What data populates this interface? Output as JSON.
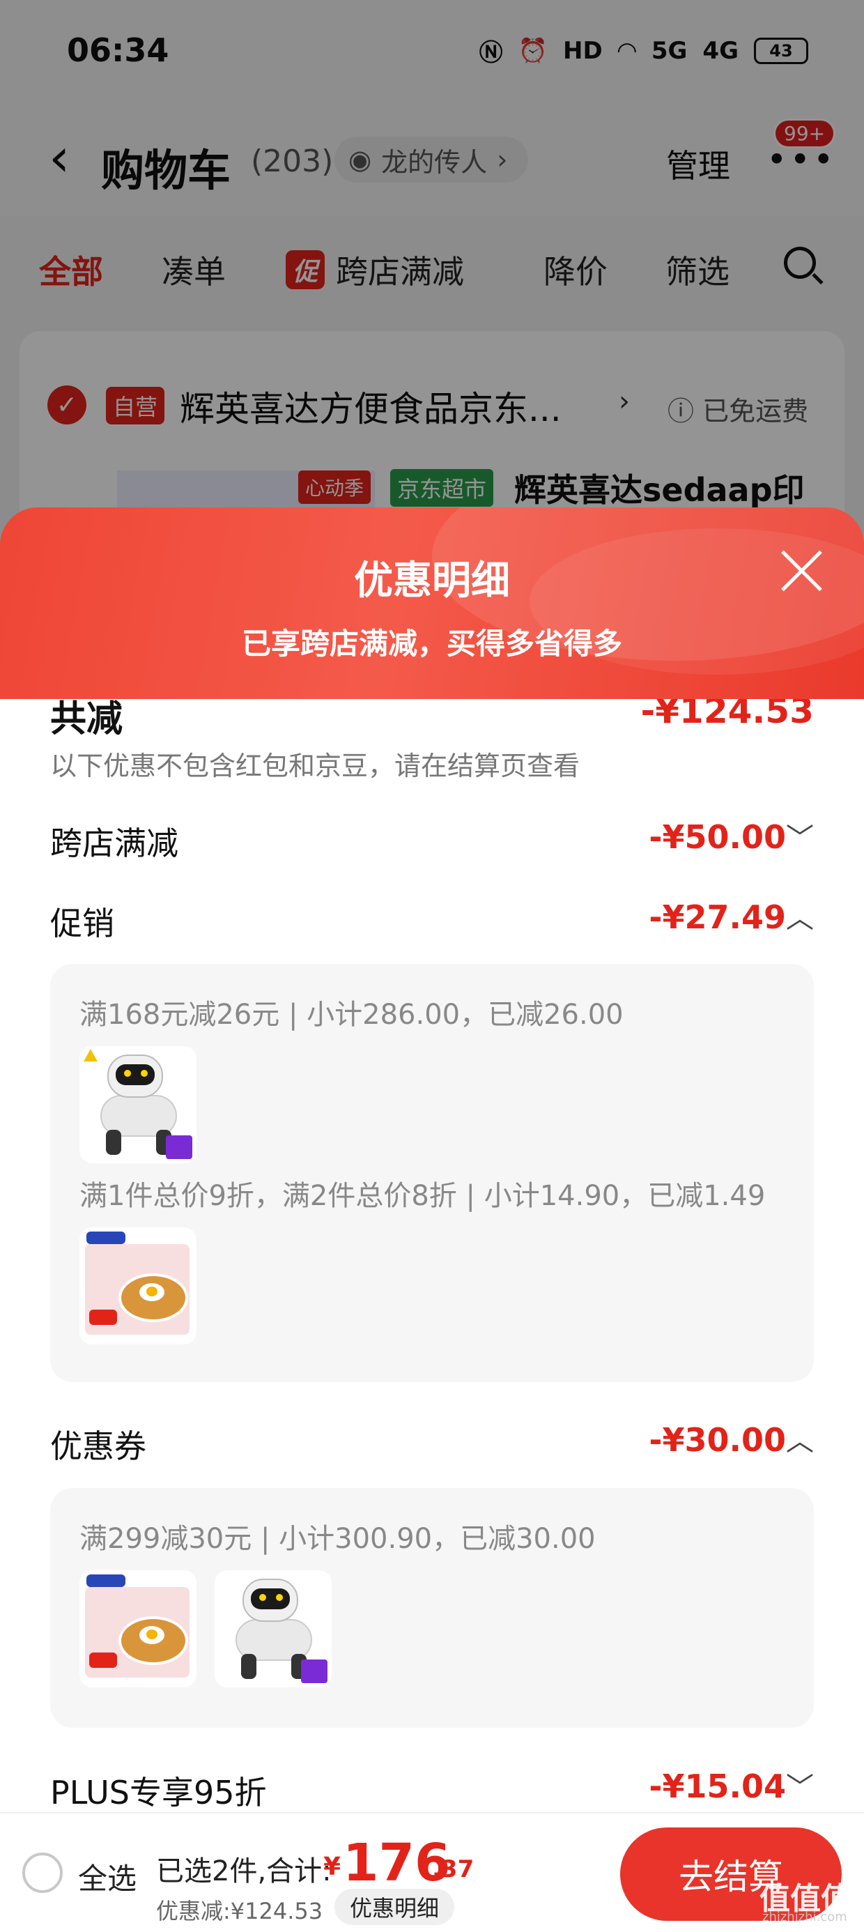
{
  "status_bar": {
    "time": "06:34",
    "icons": [
      "nfc-icon",
      "alarm-icon",
      "hd-icon",
      "wifi-icon",
      "5g-signal-icon",
      "4g-signal-icon"
    ],
    "hd_label": "HD",
    "signal_5g": "5G",
    "signal_4g": "4G",
    "battery": "43"
  },
  "cart_header": {
    "title": "购物车",
    "count": "(203)",
    "watch_label": "龙的传人",
    "manage_label": "管理",
    "badge": "99+"
  },
  "filter_tabs": {
    "all": "全部",
    "cudan": "凑单",
    "promo_tag": "促",
    "promo": "跨店满减",
    "price_drop": "降价",
    "filter": "筛选"
  },
  "shop": {
    "self_tag": "自营",
    "name": "辉英喜达方便食品京东...",
    "free_shipping": "已免运费",
    "xindongji": "心动季",
    "jd_supermarket": "京东超市",
    "product_name": "辉英喜达sedaap印"
  },
  "sheet": {
    "title": "优惠明细",
    "subtitle": "已享跨店满减，买得多省得多",
    "total_label": "共减",
    "total_value": "-¥124.53",
    "note": "以下优惠不包含红包和京豆，请在结算页查看",
    "rows": [
      {
        "label": "跨店满减",
        "value": "-¥50.00",
        "chevron": "﹀"
      },
      {
        "label": "促销",
        "value": "-¥27.49",
        "chevron": "︿"
      },
      {
        "label": "优惠券",
        "value": "-¥30.00",
        "chevron": "︿"
      },
      {
        "label": "PLUS专享95折",
        "value": "-¥15.04",
        "chevron": "﹀"
      }
    ],
    "promo_details": [
      "满168元减26元 | 小计286.00，已减26.00",
      "满1件总价9折，满2件总价8折 | 小计14.90，已减1.49"
    ],
    "coupon_details": [
      "满299减30元 | 小计300.90，已减30.00"
    ]
  },
  "bottom_bar": {
    "select_all": "全选",
    "selected_text": "已选2件,合计:",
    "currency": "¥",
    "price_int": "176",
    "price_dec": ".37",
    "discount": "优惠减:¥124.53",
    "detail_pill": "优惠明细",
    "checkout": "去结算"
  },
  "watermark": {
    "text": "值值值",
    "sub": "zhizhizhi.com"
  }
}
